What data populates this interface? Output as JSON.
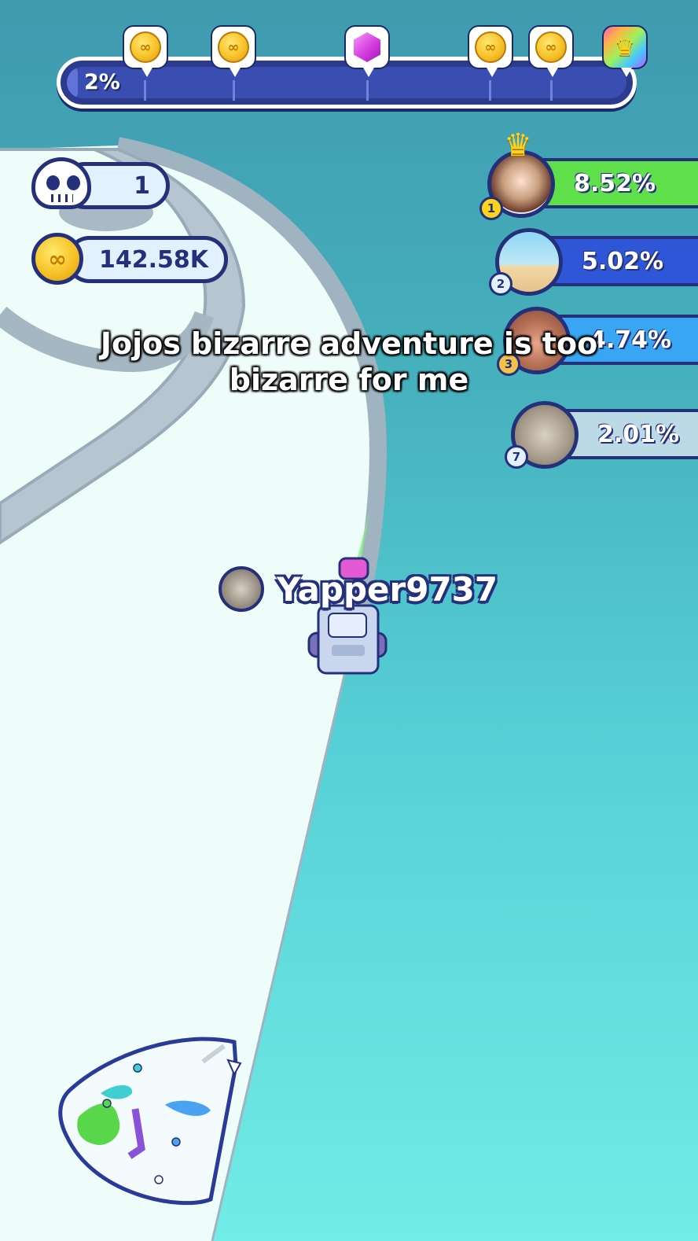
{
  "progress": {
    "percent_label": "2%",
    "fraction": 0.02,
    "milestones": [
      {
        "type": "coin",
        "icon": "coin-icon"
      },
      {
        "type": "coin",
        "icon": "coin-icon"
      },
      {
        "type": "gem",
        "icon": "gem-icon"
      },
      {
        "type": "coin",
        "icon": "coin-icon"
      },
      {
        "type": "coin",
        "icon": "coin-icon"
      },
      {
        "type": "crown",
        "icon": "crown-icon"
      }
    ]
  },
  "stats": {
    "kills": "1",
    "kills_icon": "skull-icon",
    "coins": "142.58K",
    "coins_icon": "coin-icon"
  },
  "leaderboard": [
    {
      "rank": "1",
      "percent": "8.52%",
      "color": "#5fe04a",
      "crown": true
    },
    {
      "rank": "2",
      "percent": "5.02%",
      "color": "#2f56d6"
    },
    {
      "rank": "3",
      "percent": "4.74%",
      "color": "#38a6f2"
    },
    {
      "rank": "7",
      "percent": "2.01%",
      "color": "#bcd9e6"
    }
  ],
  "player": {
    "name": "Yapper9737"
  },
  "caption": {
    "line1": "Jojos bizarre adventure is too",
    "line2": "bizarre for me"
  },
  "colors": {
    "outline": "#24307a",
    "territory": "#eefcfa",
    "sea_top": "#3f9aae",
    "sea_bottom": "#72ece6"
  }
}
